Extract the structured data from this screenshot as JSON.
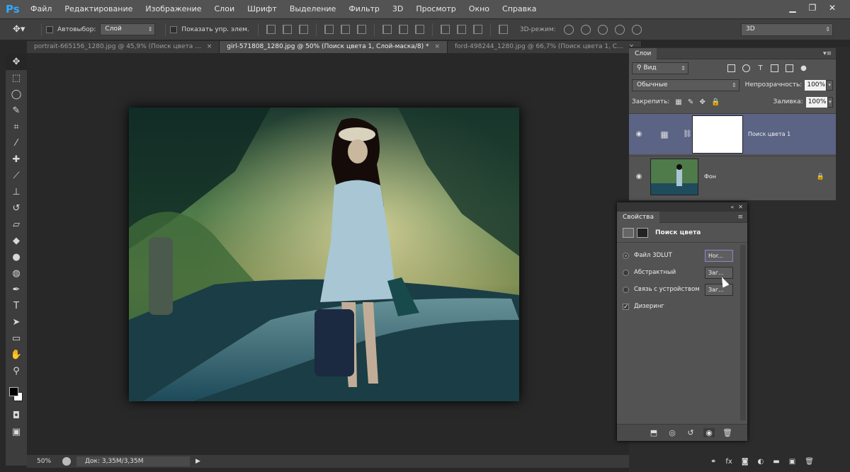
{
  "app": {
    "logo": "Ps"
  },
  "menu": [
    "Файл",
    "Редактирование",
    "Изображение",
    "Слои",
    "Шрифт",
    "Выделение",
    "Фильтр",
    "3D",
    "Просмотр",
    "Окно",
    "Справка"
  ],
  "window_controls": {
    "min": "▁",
    "restore": "❐",
    "close": "✕"
  },
  "options": {
    "autoselect_label": "Автовыбор:",
    "autoselect_value": "Слой",
    "show_controls_label": "Показать упр. элем.",
    "mode_3d_label": "3D-режим:",
    "workspace_value": "3D"
  },
  "tabs": [
    {
      "label": "portrait-665156_1280.jpg @ 45,9% (Поиск цвета ...",
      "active": false
    },
    {
      "label": "girl-571808_1280.jpg @ 50% (Поиск цвета 1, Слой-маска/8) *",
      "active": true
    },
    {
      "label": "ford-498244_1280.jpg @ 66,7% (Поиск цвета 1, С...",
      "active": false
    }
  ],
  "status": {
    "zoom": "50%",
    "doc": "Док: 3,35M/3,35M",
    "arrow": "▶"
  },
  "layers_panel": {
    "tab": "Слои",
    "filter_value": "Вид",
    "blend_mode": "Обычные",
    "opacity_label": "Непрозрачность:",
    "opacity_value": "100%",
    "lock_label": "Закрепить:",
    "fill_label": "Заливка:",
    "fill_value": "100%",
    "layers": [
      {
        "name": "Поиск цвета 1",
        "selected": true
      },
      {
        "name": "Фон",
        "selected": false
      }
    ]
  },
  "properties": {
    "tab": "Свойства",
    "title": "Поиск цвета",
    "options": [
      {
        "label": "Файл 3DLUT",
        "value": "Hor...",
        "checked": true
      },
      {
        "label": "Абстрактный",
        "value": "Заг...",
        "checked": false
      },
      {
        "label": "Связь с устройством",
        "value": "Заг...",
        "checked": false
      }
    ],
    "dither_label": "Дизеринг",
    "dither_checked": true
  },
  "icons": [
    "move-icon",
    "marquee-icon",
    "lasso-icon",
    "quick-select-icon",
    "crop-icon",
    "eyedropper-icon",
    "healing-icon",
    "brush-icon",
    "stamp-icon",
    "history-brush-icon",
    "eraser-icon",
    "bucket-icon",
    "blur-icon",
    "dodge-icon",
    "pen-icon",
    "type-icon",
    "path-select-icon",
    "rectangle-icon",
    "hand-icon",
    "zoom-icon"
  ]
}
